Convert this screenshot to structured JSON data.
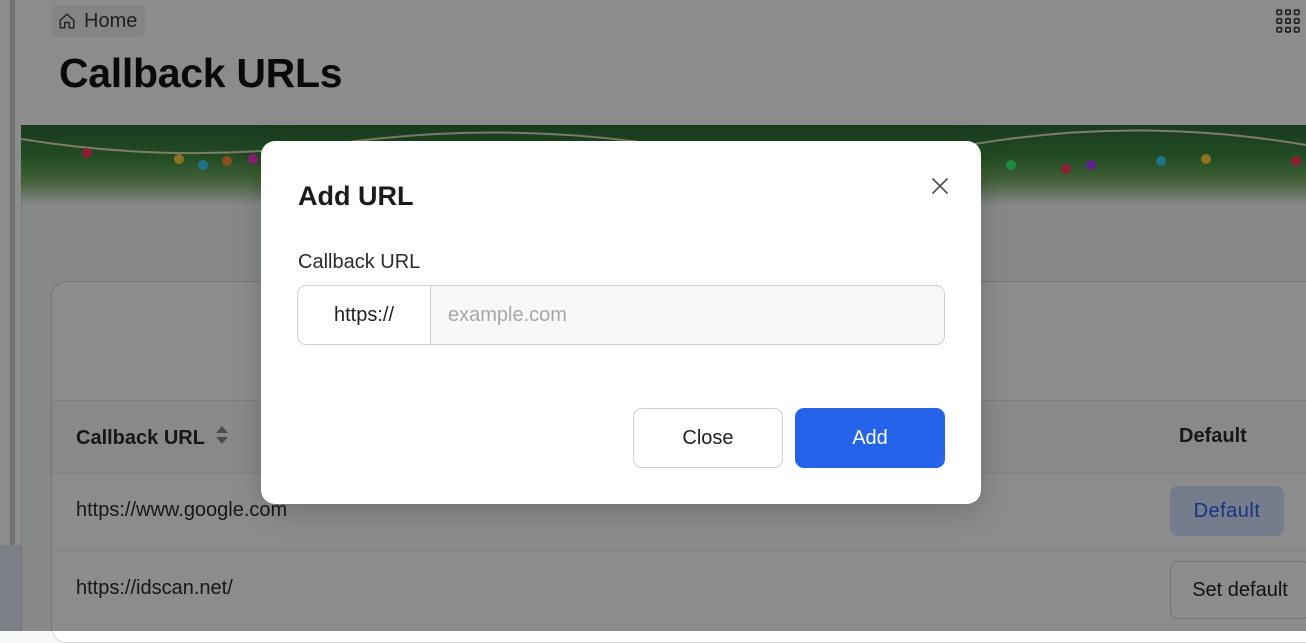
{
  "breadcrumb": {
    "label": "Home",
    "icon": "home-icon"
  },
  "page": {
    "title": "Callback URLs"
  },
  "header": {
    "apps_icon": "grid-icon"
  },
  "table": {
    "columns": {
      "callback_url": "Callback URL",
      "default": "Default"
    },
    "rows": [
      {
        "url": "https://www.google.com",
        "status_label": "Default"
      },
      {
        "url": "https://idscan.net/",
        "action_label": "Set default"
      }
    ]
  },
  "modal": {
    "title": "Add URL",
    "field_label": "Callback URL",
    "prefix": "https://",
    "input_value": "",
    "placeholder": "example.com",
    "close_label": "Close",
    "add_label": "Add",
    "close_icon": "close-icon"
  },
  "colors": {
    "accent": "#2563eb",
    "default_badge_bg": "#d6e4ff",
    "overlay": "rgba(0,0,0,0.45)"
  }
}
